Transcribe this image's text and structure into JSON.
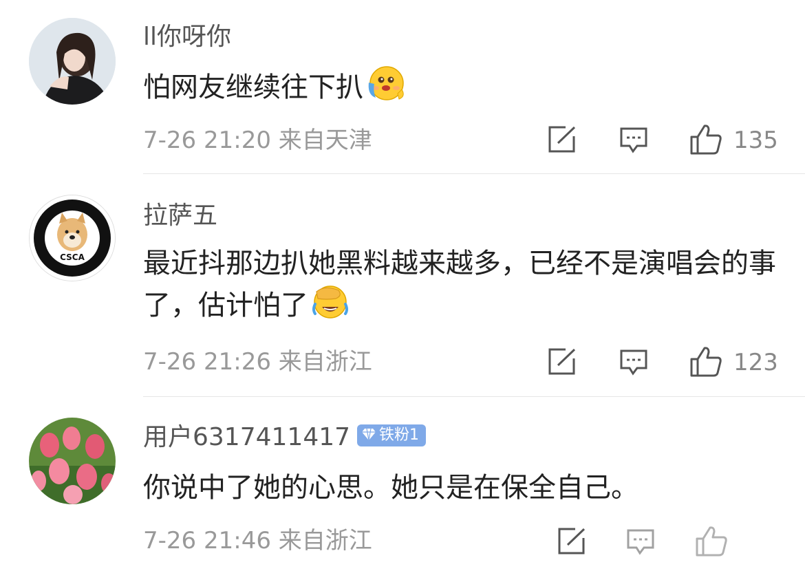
{
  "comments": [
    {
      "username": "ll你呀你",
      "text": "怕网友继续往下扒",
      "time": "7-26 21:20",
      "location": "来自天津",
      "likes": "135",
      "emoji": "hugging-face-emoji"
    },
    {
      "username": "拉萨五",
      "text": "最近抖那边扒她黑料越来越多，已经不是演唱会的事了，估计怕了",
      "time": "7-26 21:26",
      "location": "来自浙江",
      "likes": "123",
      "emoji": "face-palm-laughing-emoji",
      "avatar_text": "CSCA"
    },
    {
      "username": "用户6317411417",
      "badge": "铁粉1",
      "text": "你说中了她的心思。她只是在保全自己。",
      "time": "7-26 21:46",
      "location": "来自浙江"
    }
  ],
  "icons": {
    "share": "share-icon",
    "comment": "comment-icon",
    "like": "thumb-up-icon"
  },
  "colors": {
    "meta": "#999999",
    "badge": "#7fa9e8"
  }
}
